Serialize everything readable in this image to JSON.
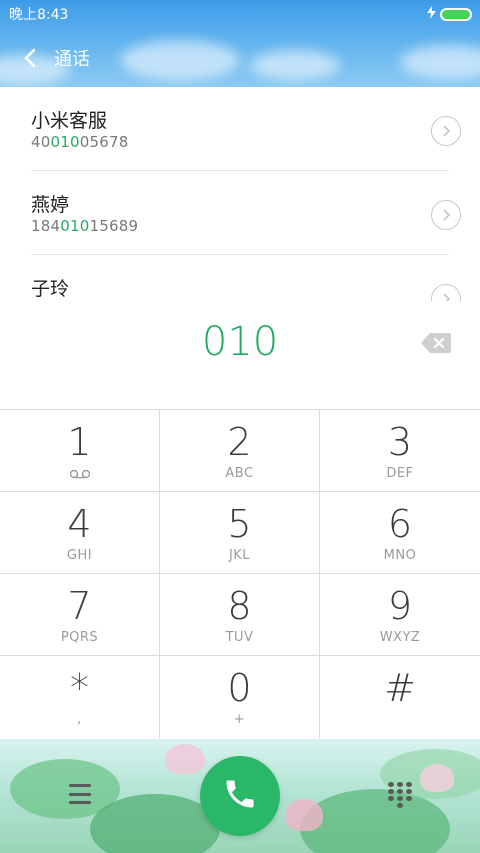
{
  "status_bar": {
    "time": "晚上8:43"
  },
  "app_bar": {
    "title": "通话",
    "back_icon": "chevron-left-icon"
  },
  "results": [
    {
      "name": "小米客服",
      "number_pre": "40",
      "number_match": "010",
      "number_post": "05678"
    },
    {
      "name": "燕婷",
      "number_pre": "184",
      "number_match": "010",
      "number_post": "15689"
    },
    {
      "name": "子玲",
      "number_pre": "",
      "number_match": "",
      "number_post": ""
    }
  ],
  "dial_input": {
    "value": "010",
    "backspace_icon": "backspace-icon"
  },
  "keypad": [
    {
      "digit": "1",
      "letters": "",
      "sub_icon": "voicemail-icon"
    },
    {
      "digit": "2",
      "letters": "ABC"
    },
    {
      "digit": "3",
      "letters": "DEF"
    },
    {
      "digit": "4",
      "letters": "GHI"
    },
    {
      "digit": "5",
      "letters": "JKL"
    },
    {
      "digit": "6",
      "letters": "MNO"
    },
    {
      "digit": "7",
      "letters": "PQRS"
    },
    {
      "digit": "8",
      "letters": "TUV"
    },
    {
      "digit": "9",
      "letters": "WXYZ"
    },
    {
      "digit": "*",
      "letters": ","
    },
    {
      "digit": "0",
      "letters": "+"
    },
    {
      "digit": "#",
      "letters": ""
    }
  ],
  "bottom_bar": {
    "menu_icon": "menu-icon",
    "call_icon": "phone-icon",
    "dialpad_icon": "dialpad-icon"
  },
  "colors": {
    "accent_green": "#2bb76a",
    "header_blue": "#3c9ce8",
    "highlight_green": "#2aaa65"
  }
}
